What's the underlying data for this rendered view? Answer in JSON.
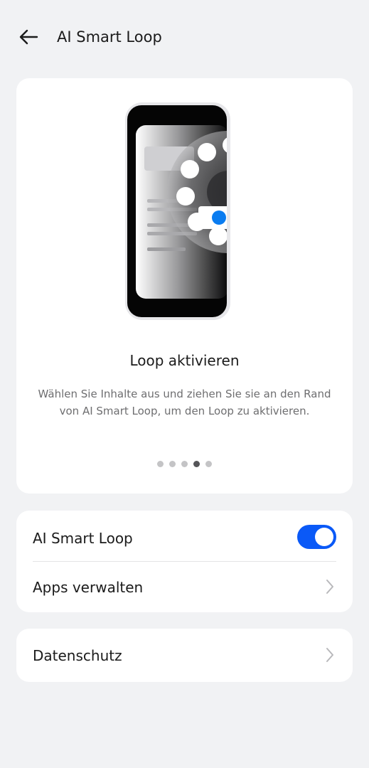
{
  "header": {
    "back_icon": "arrow-left-icon",
    "title": "AI Smart Loop"
  },
  "intro": {
    "illustration_icon": "phone-loop-illustration",
    "title": "Loop aktivieren",
    "description": "Wählen Sie Inhalte aus und ziehen Sie sie an den Rand von AI Smart Loop, um den Loop zu aktivieren.",
    "page_count": 5,
    "active_page": 4
  },
  "settings": {
    "loop_label": "AI Smart Loop",
    "loop_enabled": true,
    "apps_label": "Apps verwalten",
    "chevron_icon": "chevron-right-icon"
  },
  "privacy": {
    "label": "Datenschutz"
  },
  "colors": {
    "background": "#f1f2f4",
    "card": "#ffffff",
    "accent": "#0a59f7",
    "text_primary": "#1b1b1b",
    "text_secondary": "#6e6e70"
  }
}
